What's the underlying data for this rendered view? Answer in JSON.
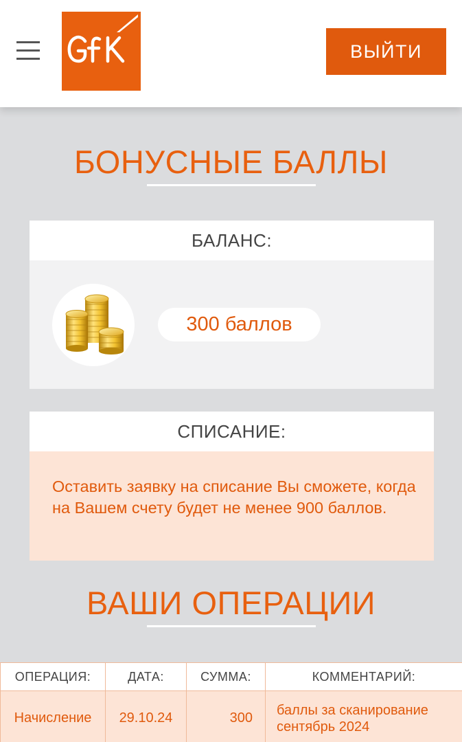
{
  "header": {
    "logo_text": "GfK",
    "logout_label": "ВЫЙТИ",
    "menu_icon": "hamburger-menu-icon",
    "brand_color": "#e8600f"
  },
  "bonus": {
    "title": "БОНУСНЫЕ БАЛЛЫ",
    "balance_header": "БАЛАНС:",
    "balance_value": "300 баллов",
    "coin_icon": "gold-coins-icon"
  },
  "writeoff": {
    "header": "СПИСАНИЕ:",
    "message": "Оставить заявку на списание Вы сможете, когда на Вашем счету будет не менее 900 баллов."
  },
  "operations": {
    "title": "ВАШИ ОПЕРАЦИИ",
    "columns": {
      "operation": "ОПЕРАЦИЯ:",
      "date": "ДАТА:",
      "amount": "СУММА:",
      "comment": "КОММЕНТАРИЙ:"
    },
    "rows": [
      {
        "operation": "Начисление",
        "date": "29.10.24",
        "amount": "300",
        "comment": "баллы за сканирование сентябрь 2024"
      }
    ]
  }
}
